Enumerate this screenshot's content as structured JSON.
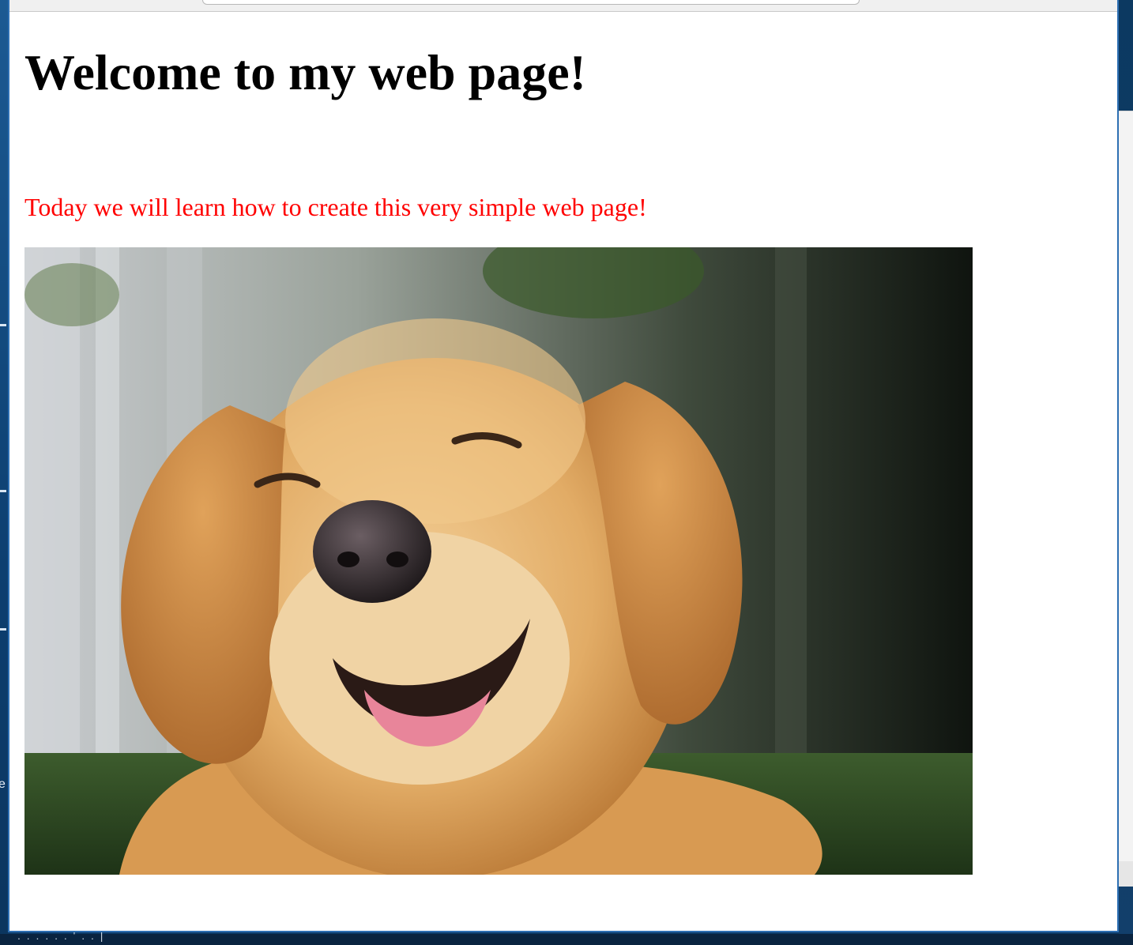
{
  "page": {
    "title": "Welcome to my web page!",
    "subtitle": "Today we will learn how to create this very simple web page!",
    "subtitle_color": "#ff0000"
  },
  "image": {
    "subject": "smiling golden retriever dog",
    "icon": "dog-photo"
  }
}
